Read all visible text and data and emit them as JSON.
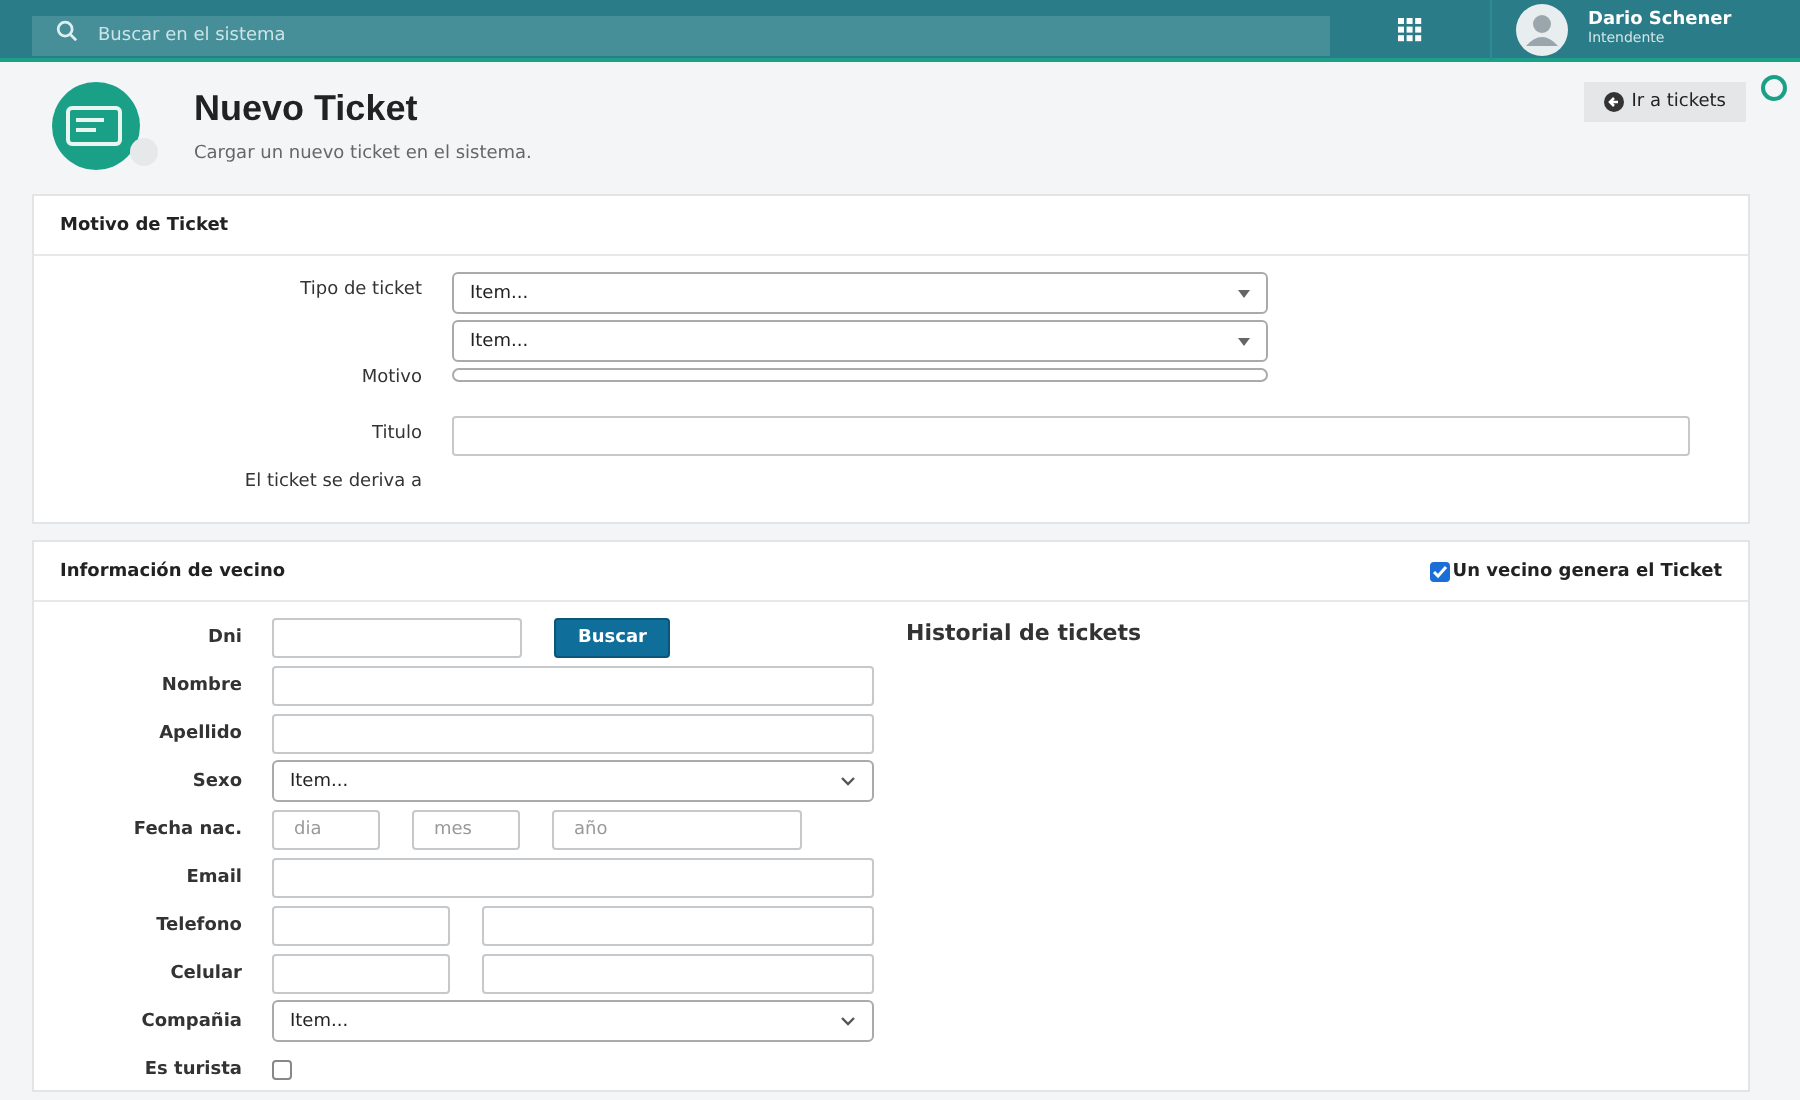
{
  "topbar": {
    "search": {
      "placeholder": "Buscar en el sistema"
    },
    "user": {
      "name": "Dario Schener",
      "role": "Intendente"
    }
  },
  "header": {
    "title": "Nuevo Ticket",
    "subtitle": "Cargar un nuevo ticket en el sistema.",
    "back_button": "Ir a tickets"
  },
  "motivo_card": {
    "title": "Motivo de Ticket",
    "rows": [
      {
        "label": "Tipo de ticket",
        "kind": "select",
        "value": "Item..."
      },
      {
        "label": "",
        "kind": "select",
        "value": "Item..."
      },
      {
        "label": "Motivo",
        "kind": "thin-select"
      },
      {
        "label": "Titulo",
        "kind": "wide-input"
      },
      {
        "label": "El ticket se deriva a",
        "kind": "none"
      }
    ]
  },
  "vecino_card": {
    "title": "Información de vecino",
    "toggle": {
      "label": "Un vecino genera el Ticket",
      "checked": true
    },
    "history_title": "Historial de tickets",
    "rows": [
      {
        "label": "Dni",
        "kind": "search",
        "button": "Buscar"
      },
      {
        "label": "Nombre",
        "kind": "input"
      },
      {
        "label": "Apellido",
        "kind": "input"
      },
      {
        "label": "Sexo",
        "kind": "select",
        "value": "Item..."
      },
      {
        "label": "Fecha nac.",
        "kind": "date",
        "placeholders": [
          "dia",
          "mes",
          "año"
        ]
      },
      {
        "label": "Email",
        "kind": "input"
      },
      {
        "label": "Telefono",
        "kind": "split"
      },
      {
        "label": "Celular",
        "kind": "split"
      },
      {
        "label": "Compañia",
        "kind": "select",
        "value": "Item..."
      },
      {
        "label": "Es turista",
        "kind": "checkbox",
        "checked": false
      }
    ]
  }
}
